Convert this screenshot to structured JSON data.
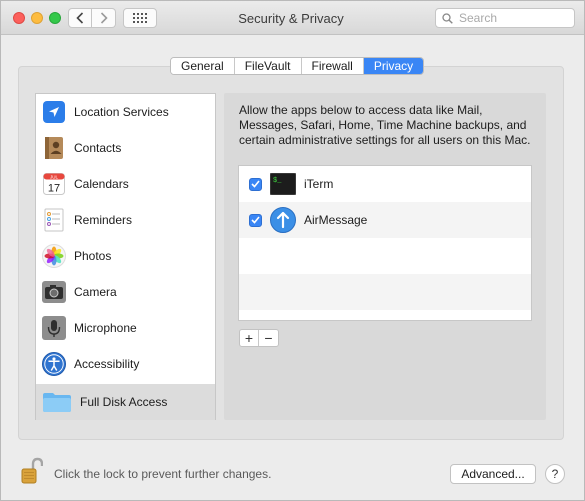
{
  "window": {
    "title": "Security & Privacy",
    "search_placeholder": "Search"
  },
  "tabs": [
    {
      "label": "General",
      "active": false
    },
    {
      "label": "FileVault",
      "active": false
    },
    {
      "label": "Firewall",
      "active": false
    },
    {
      "label": "Privacy",
      "active": true
    }
  ],
  "sidebar": {
    "items": [
      {
        "label": "Location Services",
        "icon": "location-arrow-icon"
      },
      {
        "label": "Contacts",
        "icon": "contacts-book-icon"
      },
      {
        "label": "Calendars",
        "icon": "calendar-icon",
        "icon_month": "JUL",
        "icon_day": "17"
      },
      {
        "label": "Reminders",
        "icon": "reminders-list-icon"
      },
      {
        "label": "Photos",
        "icon": "photos-flower-icon"
      },
      {
        "label": "Camera",
        "icon": "camera-icon"
      },
      {
        "label": "Microphone",
        "icon": "microphone-icon"
      },
      {
        "label": "Accessibility",
        "icon": "accessibility-icon"
      },
      {
        "label": "Full Disk Access",
        "icon": "folder-icon",
        "selected": true
      }
    ]
  },
  "main": {
    "description": "Allow the apps below to access data like Mail, Messages, Safari, Home, Time Machine backups, and certain administrative settings for all users on this Mac.",
    "apps": [
      {
        "name": "iTerm",
        "checked": true,
        "icon": "terminal-icon",
        "icon_text": "$_"
      },
      {
        "name": "AirMessage",
        "checked": true,
        "icon": "airmessage-arrow-icon"
      }
    ],
    "add_label": "+",
    "remove_label": "−"
  },
  "footer": {
    "lock_text": "Click the lock to prevent further changes.",
    "advanced_label": "Advanced...",
    "help_label": "?"
  },
  "colors": {
    "accent": "#3a86f5",
    "window_bg": "#ececec"
  }
}
